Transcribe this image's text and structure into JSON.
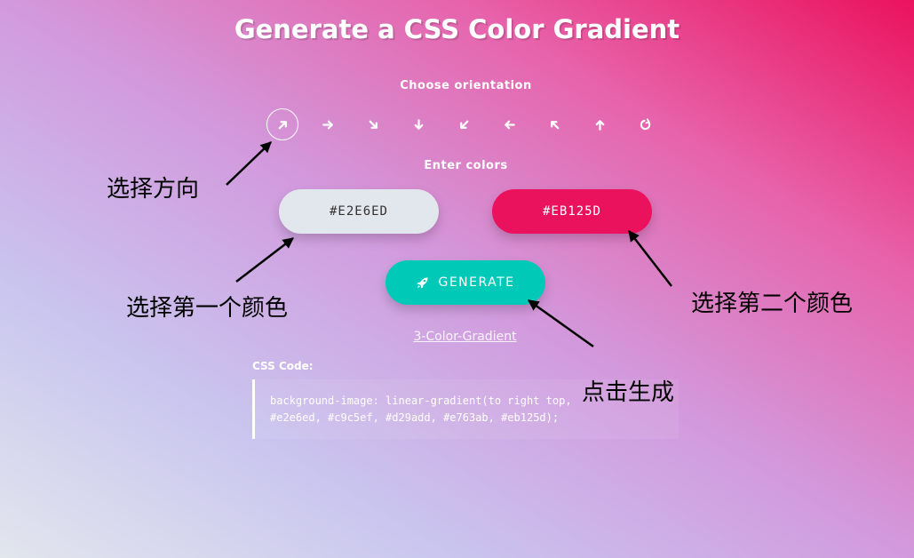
{
  "title": "Generate a CSS Color Gradient",
  "orientation": {
    "label": "Choose orientation",
    "options": [
      {
        "name": "to-right-top",
        "icon": "arrow-up-right-icon",
        "active": true
      },
      {
        "name": "to-right",
        "icon": "arrow-right-icon"
      },
      {
        "name": "to-right-bottom",
        "icon": "arrow-down-right-icon"
      },
      {
        "name": "to-bottom",
        "icon": "arrow-down-icon"
      },
      {
        "name": "to-left-bottom",
        "icon": "arrow-down-left-icon"
      },
      {
        "name": "to-left",
        "icon": "arrow-left-icon"
      },
      {
        "name": "to-left-top",
        "icon": "arrow-up-left-icon"
      },
      {
        "name": "to-top",
        "icon": "arrow-up-icon"
      },
      {
        "name": "radial",
        "icon": "rotate-icon"
      }
    ]
  },
  "colors": {
    "label": "Enter colors",
    "color1": {
      "value": "#E2E6ED",
      "bg": "#e2e6ed",
      "text": "#333333"
    },
    "color2": {
      "value": "#EB125D",
      "bg": "#eb125d",
      "text": "#ffffff"
    }
  },
  "generate": {
    "label": "GENERATE",
    "icon": "rocket-icon",
    "bg": "#00c9b7"
  },
  "three_color_link": "3-Color-Gradient",
  "css_code": {
    "label": "CSS Code:",
    "line1": "background-image: linear-gradient(to right top,",
    "line2": "#e2e6ed, #c9c5ef, #d29add, #e763ab, #eb125d);"
  },
  "annotations": {
    "orientation": "选择方向",
    "first_color": "选择第一个颜色",
    "second_color": "选择第二个颜色",
    "generate": "点击生成"
  }
}
